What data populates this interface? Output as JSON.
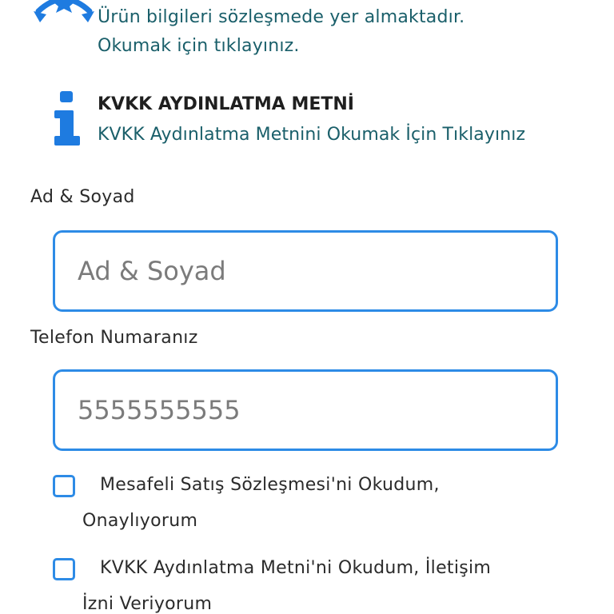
{
  "contract": {
    "line1": "Ürün bilgileri sözleşmede yer almaktadır.",
    "line2": "Okumak için tıklayınız.",
    "icon": "award-badge-icon"
  },
  "kvkk": {
    "icon": "info-icon",
    "title": "KVKK AYDINLATMA METNİ",
    "link": "KVKK Aydınlatma Metnini Okumak İçin Tıklayınız"
  },
  "form": {
    "name": {
      "label": "Ad & Soyad",
      "placeholder": "Ad & Soyad",
      "value": ""
    },
    "phone": {
      "label": "Telefon Numaranız",
      "placeholder": "5555555555",
      "value": ""
    }
  },
  "checkboxes": [
    {
      "line1": "Mesafeli Satış Sözleşmesi'ni Okudum,",
      "line2": "Onaylıyorum",
      "checked": false
    },
    {
      "line1": "KVKK Aydınlatma Metni'ni Okudum, İletişim",
      "line2": "İzni Veriyorum",
      "checked": false
    }
  ],
  "colors": {
    "accent_blue": "#2d8be6",
    "link_teal": "#1a5f6a",
    "icon_blue": "#1e7be0"
  }
}
